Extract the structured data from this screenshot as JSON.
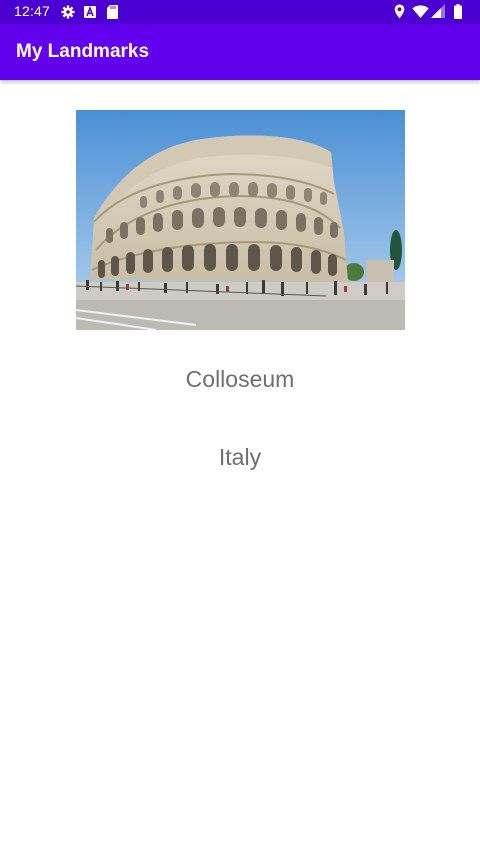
{
  "status_bar": {
    "time": "12:47",
    "left_icons": [
      "gear-icon",
      "a-box-icon",
      "sd-card-icon"
    ],
    "right_icons": [
      "location-pin-icon",
      "wifi-icon",
      "cell-signal-icon",
      "battery-icon"
    ]
  },
  "app_bar": {
    "title": "My Landmarks",
    "color": "#6200ee"
  },
  "landmark": {
    "image": "colosseum-photo",
    "name": "Colloseum",
    "country": "Italy"
  },
  "colors": {
    "status_bar": "#4b00d1",
    "text_secondary": "#6f6f6f"
  }
}
